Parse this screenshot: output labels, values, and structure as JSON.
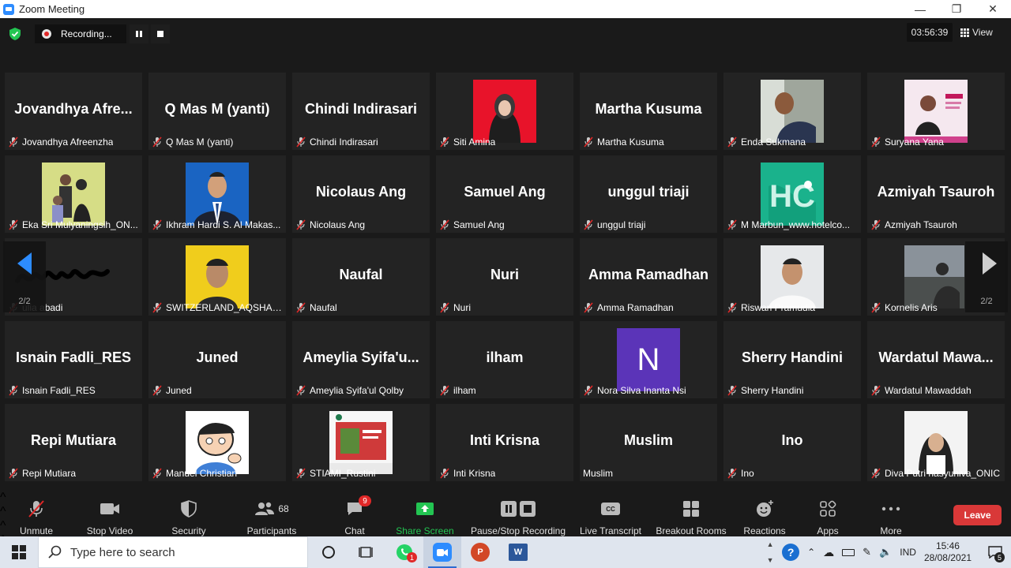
{
  "window": {
    "title": "Zoom Meeting"
  },
  "topbar": {
    "recording_label": "Recording...",
    "timer": "03:56:39",
    "view_label": "View"
  },
  "pagination": {
    "left": "2/2",
    "right": "2/2"
  },
  "tiles": [
    {
      "big": "Jovandhya  Afre...",
      "name": "Jovandhya Afreenzha",
      "photo": ""
    },
    {
      "big": "Q Mas M (yanti)",
      "name": "Q Mas M (yanti)",
      "photo": ""
    },
    {
      "big": "Chindi Indirasari",
      "name": "Chindi Indirasari",
      "photo": ""
    },
    {
      "big": "",
      "name": "Siti Amina",
      "photo": "hijab-red"
    },
    {
      "big": "Martha Kusuma",
      "name": "Martha Kusuma",
      "photo": ""
    },
    {
      "big": "",
      "name": "Enda Sukmana",
      "photo": "man-selfie"
    },
    {
      "big": "",
      "name": "Suryana Yana",
      "photo": "poster"
    },
    {
      "big": "",
      "name": "Eka Sri Mulyaningsih_ON...",
      "photo": "family"
    },
    {
      "big": "",
      "name": "Ikhram Hardi S. Al Makas...",
      "photo": "suit-blue"
    },
    {
      "big": "Nicolaus Ang",
      "name": "Nicolaus Ang",
      "photo": ""
    },
    {
      "big": "Samuel Ang",
      "name": "Samuel Ang",
      "photo": ""
    },
    {
      "big": "unggul triaji",
      "name": "unggul triaji",
      "photo": ""
    },
    {
      "big": "",
      "name": "M Marbun_www.hotelco...",
      "photo": "logo-green"
    },
    {
      "big": "Azmiyah Tsauroh",
      "name": "Azmiyah Tsauroh",
      "photo": ""
    },
    {
      "big": "",
      "name": "ulia abadi",
      "photo": "signature"
    },
    {
      "big": "",
      "name": "SWITZERLAND_AQSHAL I...",
      "photo": "yellow-portrait"
    },
    {
      "big": "Naufal",
      "name": "Naufal",
      "photo": ""
    },
    {
      "big": "Nuri",
      "name": "Nuri",
      "photo": ""
    },
    {
      "big": "Amma Ramadhan",
      "name": "Amma Ramadhan",
      "photo": ""
    },
    {
      "big": "",
      "name": "Riswan Pramudia",
      "photo": "man-white"
    },
    {
      "big": "",
      "name": "Kornelis Aris",
      "photo": "silhouette"
    },
    {
      "big": "Isnain Fadli_RES",
      "name": "Isnain Fadli_RES",
      "photo": ""
    },
    {
      "big": "Juned",
      "name": "Juned",
      "photo": ""
    },
    {
      "big": "Ameylia  Syifa'u...",
      "name": "Ameylia Syifa'ul Qolby",
      "photo": ""
    },
    {
      "big": "ilham",
      "name": "ilham",
      "photo": ""
    },
    {
      "big": "",
      "name": "Nora Silva Inanta Nsi",
      "photo": "letter-n",
      "letter": "N"
    },
    {
      "big": "Sherry Handini",
      "name": "Sherry Handini",
      "photo": ""
    },
    {
      "big": "Wardatul  Mawa...",
      "name": "Wardatul Mawaddah",
      "photo": ""
    },
    {
      "big": "Repi Mutiara",
      "name": "Repi Mutiara",
      "photo": ""
    },
    {
      "big": "",
      "name": "Manuel Christian",
      "photo": "cartoon"
    },
    {
      "big": "",
      "name": "STIAMI_Rustini",
      "photo": "poster-red"
    },
    {
      "big": "Inti Krisna",
      "name": "Inti Krisna",
      "photo": ""
    },
    {
      "big": "Muslim",
      "name": "Muslim",
      "photo": "",
      "nomic": true
    },
    {
      "big": "Ino",
      "name": "Ino",
      "photo": ""
    },
    {
      "big": "",
      "name": "Diva Putri hasyuniva_ONIC",
      "photo": "hijab-white"
    }
  ],
  "toolbar": {
    "unmute": "Unmute",
    "stop_video": "Stop Video",
    "security": "Security",
    "participants": "Participants",
    "participants_count": "68",
    "chat": "Chat",
    "chat_badge": "9",
    "share_screen": "Share Screen",
    "pause_stop_recording": "Pause/Stop Recording",
    "live_transcript": "Live Transcript",
    "breakout_rooms": "Breakout Rooms",
    "reactions": "Reactions",
    "apps": "Apps",
    "more": "More",
    "leave": "Leave",
    "cc": "CC"
  },
  "taskbar": {
    "search_placeholder": "Type here to search",
    "whatsapp_badge": "1",
    "lang": "IND",
    "time": "15:46",
    "date": "28/08/2021",
    "notifications": "5"
  },
  "colors": {
    "accent": "#2d8cff",
    "leave": "#d93838",
    "share": "#23c552",
    "badge": "#e02828"
  }
}
